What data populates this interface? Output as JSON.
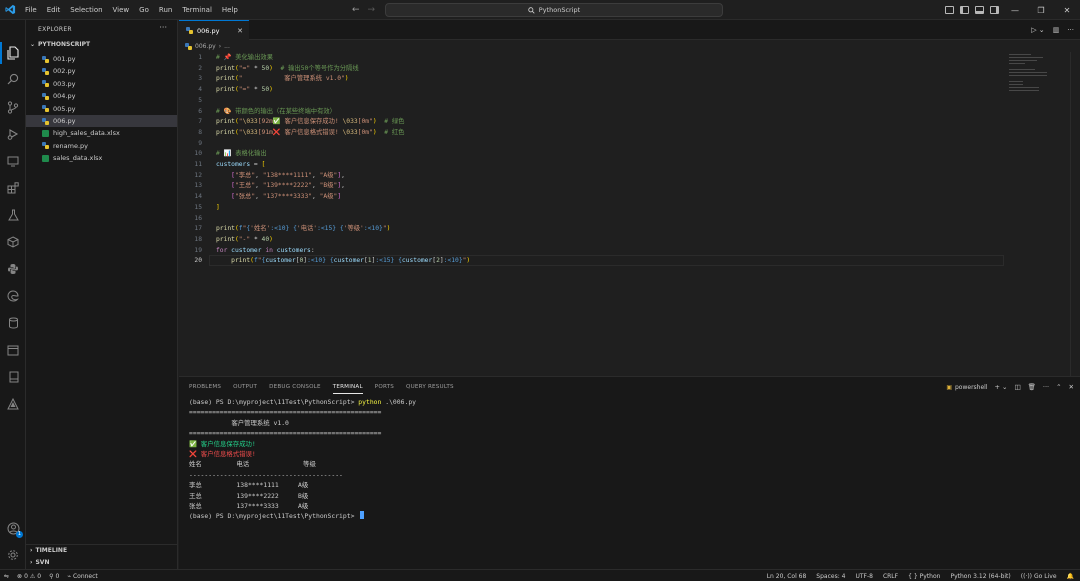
{
  "titlebar": {
    "menu": [
      "File",
      "Edit",
      "Selection",
      "View",
      "Go",
      "Run",
      "Terminal",
      "Help"
    ],
    "search_text": "PythonScript"
  },
  "sidebar": {
    "title": "EXPLORER",
    "folder": "PYTHONSCRIPT",
    "files": [
      {
        "name": "001.py",
        "type": "py"
      },
      {
        "name": "002.py",
        "type": "py"
      },
      {
        "name": "003.py",
        "type": "py"
      },
      {
        "name": "004.py",
        "type": "py"
      },
      {
        "name": "005.py",
        "type": "py"
      },
      {
        "name": "006.py",
        "type": "py"
      },
      {
        "name": "high_sales_data.xlsx",
        "type": "xlsx"
      },
      {
        "name": "rename.py",
        "type": "py"
      },
      {
        "name": "sales_data.xlsx",
        "type": "xlsx"
      }
    ],
    "active_file": "006.py",
    "timeline_label": "TIMELINE",
    "svn_label": "SVN"
  },
  "editor": {
    "tab_label": "006.py",
    "breadcrumb_file": "006.py",
    "breadcrumb_more": "...",
    "current_line": 20
  },
  "code_lines": [
    {
      "n": "1",
      "html": "<span class='tk-cm'># 📌 美化输出效果</span>"
    },
    {
      "n": "2",
      "html": "<span class='tk-fn'>print</span><span class='tk-br'>(</span><span class='tk-str'>\"=\"</span> <span class='tk-op'>*</span> <span class='tk-num'>50</span><span class='tk-br'>)</span>  <span class='tk-cm'># 输出50个等号作为分隔线</span>"
    },
    {
      "n": "3",
      "html": "<span class='tk-fn'>print</span><span class='tk-br'>(</span><span class='tk-str'>\"           客户管理系统 v1.0\"</span><span class='tk-br'>)</span>"
    },
    {
      "n": "4",
      "html": "<span class='tk-fn'>print</span><span class='tk-br'>(</span><span class='tk-str'>\"=\"</span> <span class='tk-op'>*</span> <span class='tk-num'>50</span><span class='tk-br'>)</span>"
    },
    {
      "n": "5",
      "html": ""
    },
    {
      "n": "6",
      "html": "<span class='tk-cm'># 🎨 带颜色的输出（在某些终端中有效）</span>"
    },
    {
      "n": "7",
      "html": "<span class='tk-fn'>print</span><span class='tk-br'>(</span><span class='tk-str'>\"<span class='tk-esc'>\\033</span>[92m✅ 客户信息保存成功! <span class='tk-esc'>\\033</span>[0m\"</span><span class='tk-br'>)</span>  <span class='tk-cm'># 绿色</span>"
    },
    {
      "n": "8",
      "html": "<span class='tk-fn'>print</span><span class='tk-br'>(</span><span class='tk-str'>\"<span class='tk-esc'>\\033</span>[91m❌ 客户信息格式错误! <span class='tk-esc'>\\033</span>[0m\"</span><span class='tk-br'>)</span>  <span class='tk-cm'># 红色</span>"
    },
    {
      "n": "9",
      "html": ""
    },
    {
      "n": "10",
      "html": "<span class='tk-cm'># 📊 表格化输出</span>"
    },
    {
      "n": "11",
      "html": "<span class='tk-var'>customers</span> <span class='tk-op'>=</span> <span class='tk-br'>[</span>"
    },
    {
      "n": "12",
      "html": "    <span class='tk-br2'>[</span><span class='tk-str'>\"李总\"</span>, <span class='tk-str'>\"138****1111\"</span>, <span class='tk-str'>\"A级\"</span><span class='tk-br2'>]</span>,"
    },
    {
      "n": "13",
      "html": "    <span class='tk-br2'>[</span><span class='tk-str'>\"王总\"</span>, <span class='tk-str'>\"139****2222\"</span>, <span class='tk-str'>\"B级\"</span><span class='tk-br2'>]</span>,"
    },
    {
      "n": "14",
      "html": "    <span class='tk-br2'>[</span><span class='tk-str'>\"张总\"</span>, <span class='tk-str'>\"137****3333\"</span>, <span class='tk-str'>\"A级\"</span><span class='tk-br2'>]</span>"
    },
    {
      "n": "15",
      "html": "<span class='tk-br'>]</span>"
    },
    {
      "n": "16",
      "html": ""
    },
    {
      "n": "17",
      "html": "<span class='tk-fn'>print</span><span class='tk-br'>(</span><span class='tk-fmt'>f</span><span class='tk-str'>\"</span><span class='tk-fmt'>{</span><span class='tk-str'>'姓名'</span><span class='tk-fmt'>:&lt;10}</span> <span class='tk-fmt'>{</span><span class='tk-str'>'电话'</span><span class='tk-fmt'>:&lt;15}</span> <span class='tk-fmt'>{</span><span class='tk-str'>'等级'</span><span class='tk-fmt'>:&lt;10}</span><span class='tk-str'>\"</span><span class='tk-br'>)</span>"
    },
    {
      "n": "18",
      "html": "<span class='tk-fn'>print</span><span class='tk-br'>(</span><span class='tk-str'>\"-\"</span> <span class='tk-op'>*</span> <span class='tk-num'>40</span><span class='tk-br'>)</span>"
    },
    {
      "n": "19",
      "html": "<span class='tk-kw'>for</span> <span class='tk-var'>customer</span> <span class='tk-kw'>in</span> <span class='tk-var'>customers</span>:"
    },
    {
      "n": "20",
      "html": "    <span class='tk-fn'>print</span><span class='tk-br'>(</span><span class='tk-fmt'>f</span><span class='tk-str'>\"</span><span class='tk-fmt'>{</span><span class='tk-var'>customer</span>[<span class='tk-num'>0</span>]<span class='tk-fmt'>:&lt;10}</span> <span class='tk-fmt'>{</span><span class='tk-var'>customer</span>[<span class='tk-num'>1</span>]<span class='tk-fmt'>:&lt;15}</span> <span class='tk-fmt'>{</span><span class='tk-var'>customer</span>[<span class='tk-num'>2</span>]<span class='tk-fmt'>:&lt;10}</span><span class='tk-str'>\"</span><span class='tk-br'>)</span>"
    }
  ],
  "panel": {
    "tabs": [
      "PROBLEMS",
      "OUTPUT",
      "DEBUG CONSOLE",
      "TERMINAL",
      "PORTS",
      "QUERY RESULTS"
    ],
    "active_tab": "TERMINAL",
    "shell_label": "powershell"
  },
  "terminal_lines": [
    {
      "html": "(base) PS D:\\myproject\\11Test\\PythonScript&gt; <span class='t-yellow'>python</span> .\\006.py"
    },
    {
      "html": "=================================================="
    },
    {
      "html": "           客户管理系统 v1.0"
    },
    {
      "html": "=================================================="
    },
    {
      "html": "<span class='t-green'>✅ 客户信息保存成功!</span>"
    },
    {
      "html": "<span class='t-red'>❌ 客户信息格式错误!</span>"
    },
    {
      "html": "姓名         电话              等级"
    },
    {
      "html": "----------------------------------------"
    },
    {
      "html": "李总         138****1111     A级"
    },
    {
      "html": "王总         139****2222     B级"
    },
    {
      "html": "张总         137****3333     A级"
    },
    {
      "html": "(base) PS D:\\myproject\\11Test\\PythonScript&gt; <span class='t-cursor'></span>"
    }
  ],
  "statusbar": {
    "errors": "0",
    "warnings": "0",
    "info": "0",
    "connect": "Connect",
    "position": "Ln 20, Col 68",
    "spaces": "Spaces: 4",
    "encoding": "UTF-8",
    "eol": "CRLF",
    "language": "Python",
    "interpreter": "Python 3.12 (64-bit)",
    "golive": "Go Live"
  },
  "colors": {
    "accent": "#0078d4",
    "background": "#1f1f1f",
    "sidebar": "#181818"
  }
}
